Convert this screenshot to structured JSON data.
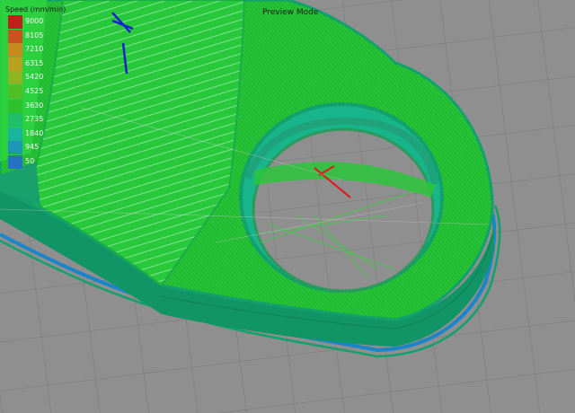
{
  "viewport": {
    "mode_label": "Preview Mode",
    "legend": {
      "title": "Speed (mm/min)",
      "items": [
        {
          "value": "9000",
          "color": "#c0201a"
        },
        {
          "value": "8105",
          "color": "#c9531c"
        },
        {
          "value": "7210",
          "color": "#c88a1e"
        },
        {
          "value": "6315",
          "color": "#b8a020"
        },
        {
          "value": "5420",
          "color": "#8fb421"
        },
        {
          "value": "4525",
          "color": "#4fbf25"
        },
        {
          "value": "3630",
          "color": "#2ec12e"
        },
        {
          "value": "2735",
          "color": "#1fbf6a"
        },
        {
          "value": "1840",
          "color": "#1ab39b"
        },
        {
          "value": "945",
          "color": "#1d97b8"
        },
        {
          "value": "50",
          "color": "#2572c4"
        }
      ]
    }
  },
  "colors": {
    "background": "#8f8f8f",
    "grid_line": "#777777",
    "infill": "#2bd63d",
    "wall": "#12a06d",
    "skirt": "#1a86c9",
    "travel": "#e01818",
    "axis": "#1722cf"
  }
}
